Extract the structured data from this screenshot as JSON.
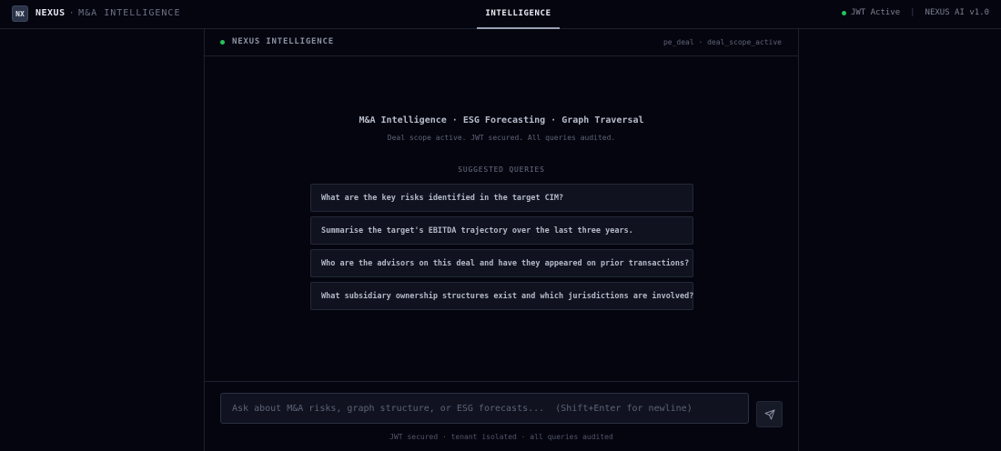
{
  "header": {
    "logo_text": "NX",
    "brand_name": "NEXUS",
    "brand_separator": "·",
    "brand_subtitle": "M&A INTELLIGENCE",
    "active_tab": "INTELLIGENCE",
    "jwt_status": "JWT Active",
    "status_separator": "|",
    "version": "NEXUS AI v1.0"
  },
  "panel": {
    "title": "NEXUS INTELLIGENCE",
    "scope": "pe_deal · deal_scope_active"
  },
  "hero": {
    "title": "M&A Intelligence · ESG Forecasting · Graph Traversal",
    "subtitle": "Deal scope active. JWT secured. All queries audited."
  },
  "suggestions": {
    "label": "SUGGESTED QUERIES",
    "items": [
      "What are the key risks identified in the target CIM?",
      "Summarise the target's EBITDA trajectory over the last three years.",
      "Who are the advisors on this deal and have they appeared on prior transactions?",
      "What subsidiary ownership structures exist and which jurisdictions are involved?"
    ]
  },
  "composer": {
    "value": "",
    "placeholder": "Ask about M&A risks, graph structure, or ESG forecasts...  (Shift+Enter for newline)",
    "send_icon": "send-icon",
    "footer": "JWT secured · tenant isolated · all queries audited"
  },
  "colors": {
    "background": "#05050f",
    "accent_green": "#22c55e",
    "card": "#10131f",
    "border": "#1c2030"
  }
}
